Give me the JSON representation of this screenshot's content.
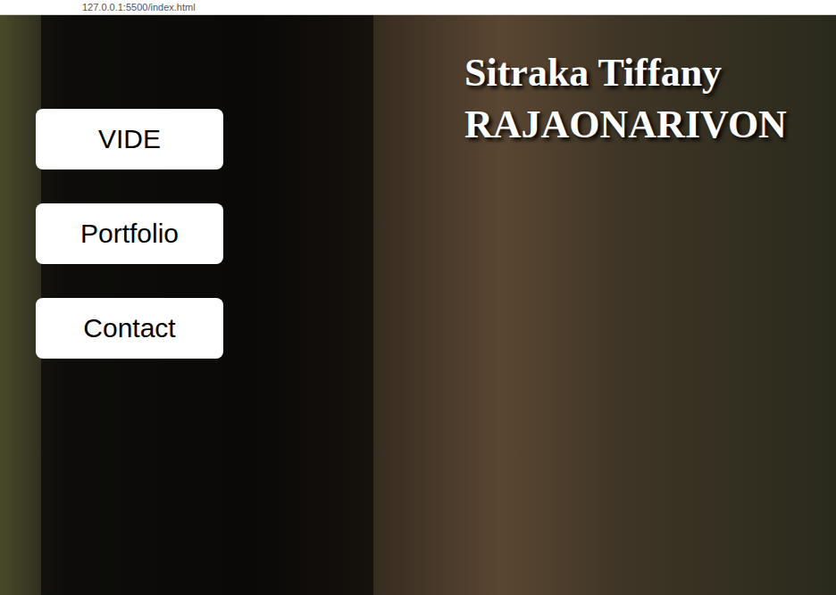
{
  "browser": {
    "address": "127.0.0.1:5500/index.html"
  },
  "nav": {
    "buttons": [
      {
        "label": "VIDE"
      },
      {
        "label": "Portfolio"
      },
      {
        "label": "Contact"
      }
    ]
  },
  "header": {
    "lines": [
      "Sitraka Tiffany",
      "RAJAONARIVON"
    ]
  }
}
